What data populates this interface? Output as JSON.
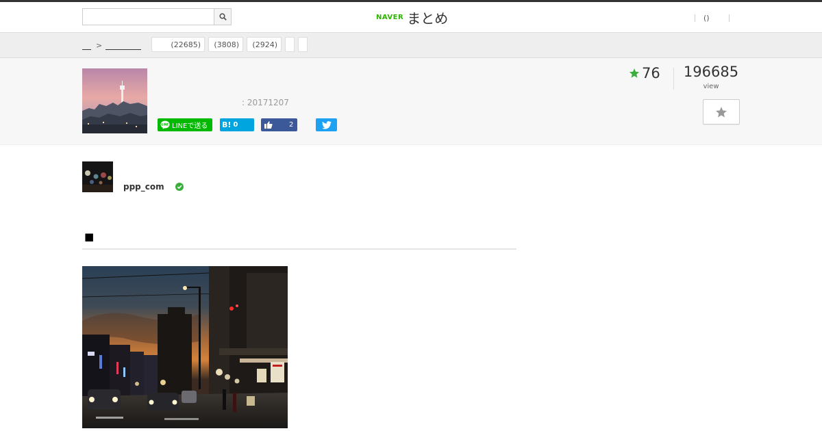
{
  "header": {
    "search": {
      "placeholder": "",
      "value": ""
    },
    "logo": {
      "brand": "NAVER",
      "name": "まとめ"
    },
    "links": [
      {
        "label": "()"
      }
    ]
  },
  "category_bar": {
    "breadcrumb_separator": ">",
    "tags": [
      {
        "count": "(22685)"
      },
      {
        "count": "(3808)"
      },
      {
        "count": "(2924)"
      },
      {
        "count": ""
      },
      {
        "count": ""
      }
    ]
  },
  "article": {
    "date": ": 20171207",
    "share": {
      "line_label": "LINEで送る",
      "hatena_label": "B!",
      "hatena_count": "0",
      "fb_count": "2"
    },
    "favorites": "76",
    "views": "196685",
    "views_label": "view"
  },
  "author": {
    "name": "ppp_com"
  },
  "section": {
    "marker": "■"
  },
  "colors": {
    "line": "#00b900",
    "hatena": "#00a4de",
    "facebook": "#3b5998",
    "twitter": "#1da1f2",
    "accent_green": "#2db400",
    "star_green": "#3cae3c"
  },
  "icons": [
    "search-icon",
    "line-icon",
    "hatena-icon",
    "like-icon",
    "twitter-icon",
    "star-icon",
    "favorite-star-icon",
    "verified-icon"
  ]
}
